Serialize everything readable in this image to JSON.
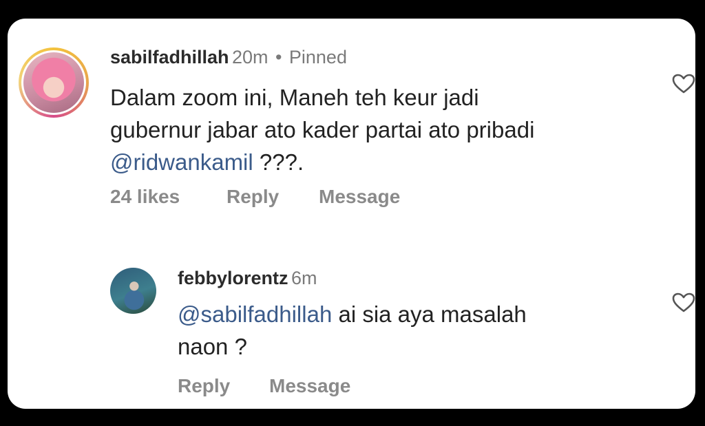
{
  "comment": {
    "username": "sabilfadhillah",
    "time": "20m",
    "separator": "•",
    "pinned": "Pinned",
    "line1": "Dalam zoom ini, Maneh teh keur jadi",
    "line2": "gubernur jabar ato kader partai ato pribadi",
    "mention": "@ridwankamil",
    "line3_suffix": " ???.",
    "likes": "24 likes",
    "reply": "Reply",
    "message": "Message",
    "like_icon": "heart-outline-icon"
  },
  "reply_comment": {
    "username": "febbylorentz",
    "time": "6m",
    "mention": "@sabilfadhillah",
    "line1_suffix": " ai sia aya masalah",
    "line2": "naon ?",
    "reply": "Reply",
    "message": "Message",
    "like_icon": "heart-outline-icon"
  },
  "colors": {
    "mention": "#3b5b8a",
    "meta": "#7a7a7a",
    "card_bg": "#ffffff",
    "page_bg": "#000000"
  }
}
